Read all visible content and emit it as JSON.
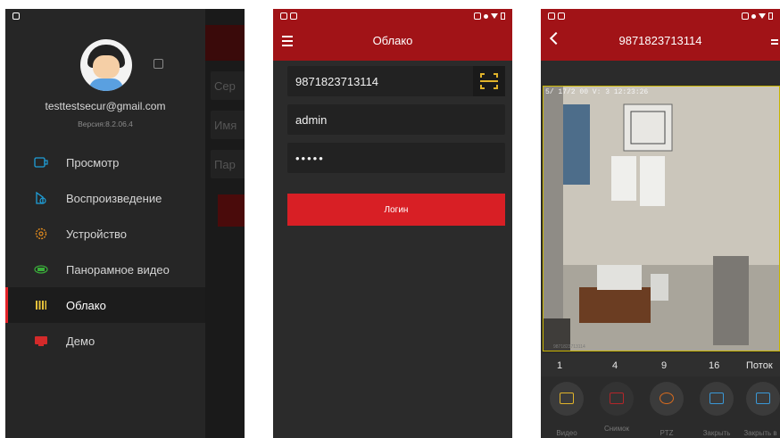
{
  "menu_screen": {
    "email": "testtestsecur@gmail.com",
    "version": "Версия:8.2.06.4",
    "items": [
      {
        "label": "Просмотр",
        "icon": "live-view-icon",
        "color": "#1f9ed8"
      },
      {
        "label": "Воспроизведение",
        "icon": "playback-icon",
        "color": "#1f9ed8"
      },
      {
        "label": "Устройство",
        "icon": "device-gear-icon",
        "color": "#e08a1e"
      },
      {
        "label": "Панорамное видео",
        "icon": "panorama-360-icon",
        "color": "#3aae3a"
      },
      {
        "label": "Облако",
        "icon": "cloud-icon",
        "color": "#e6c13a",
        "active": true
      },
      {
        "label": "Демо",
        "icon": "demo-icon",
        "color": "#d32a2a"
      }
    ],
    "background_fields": [
      "Сер",
      "Имя",
      "Пар"
    ]
  },
  "login_screen": {
    "title": "Облако",
    "serial_value": "9871823713114",
    "username_value": "admin",
    "password_value": "•••••",
    "login_label": "Логин"
  },
  "video_screen": {
    "title": "9871823713114",
    "osd_text": "5/ 17/2 00 V: 3 12:23:26",
    "camera_tag": "9871823713114",
    "split_options": [
      "1",
      "4",
      "9",
      "16",
      "Поток"
    ],
    "tools": [
      {
        "label": "Видео",
        "icon": "record-video-icon"
      },
      {
        "label": "Снимок",
        "icon": "snapshot-icon"
      },
      {
        "label": "PTZ",
        "icon": "ptz-icon"
      },
      {
        "label": "Закрыть",
        "icon": "close-window-icon"
      },
      {
        "label": "Закрыть в",
        "icon": "close-all-icon"
      }
    ]
  },
  "colors": {
    "brand_red": "#a11317",
    "button_red": "#d81f25",
    "accent_gold": "#e0b32a",
    "dark_bg": "#2b2b2b"
  }
}
